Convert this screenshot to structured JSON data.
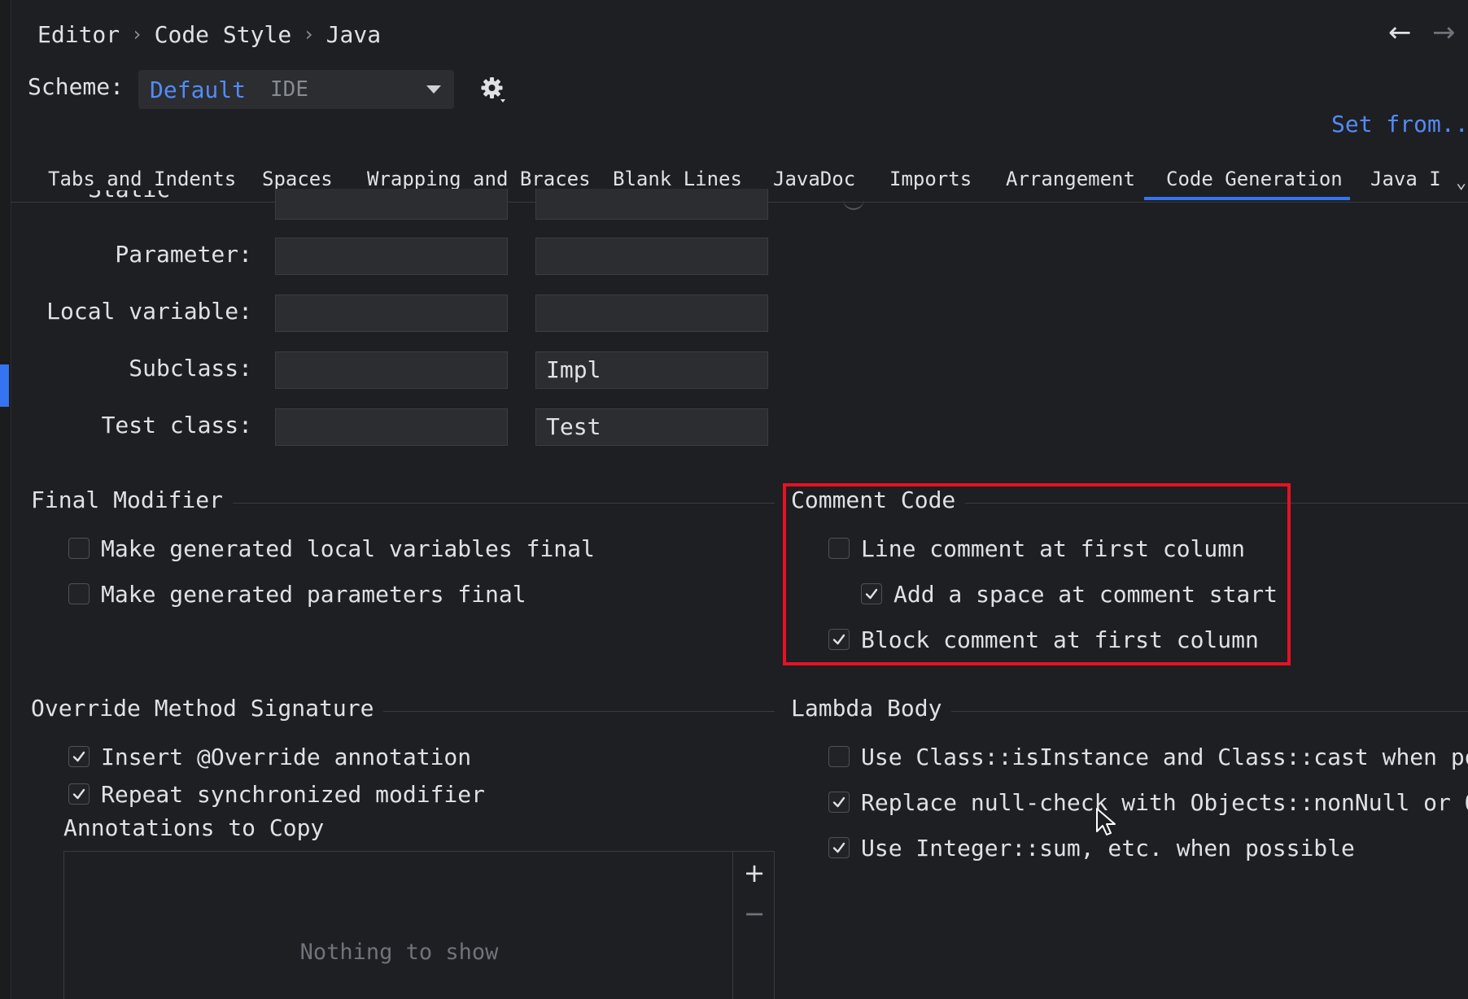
{
  "breadcrumb": [
    "Editor",
    "Code Style",
    "Java"
  ],
  "breadcrumb_separator": "›",
  "nav": {
    "back": "←",
    "forward": "→"
  },
  "scheme": {
    "label": "Scheme:",
    "name": "Default",
    "type": "IDE",
    "set_from": "Set from..."
  },
  "tabs": [
    {
      "label": "Tabs and Indents",
      "active": false
    },
    {
      "label": "Spaces",
      "active": false
    },
    {
      "label": "Wrapping and Braces",
      "active": false
    },
    {
      "label": "Blank Lines",
      "active": false
    },
    {
      "label": "JavaDoc",
      "active": false
    },
    {
      "label": "Imports",
      "active": false
    },
    {
      "label": "Arrangement",
      "active": false
    },
    {
      "label": "Code Generation",
      "active": true
    },
    {
      "label": "Java I",
      "active": false
    }
  ],
  "naming": {
    "cut_off_label": "Static field:",
    "rows": [
      {
        "label": "Parameter:",
        "prefix": "",
        "suffix": ""
      },
      {
        "label": "Local variable:",
        "prefix": "",
        "suffix": ""
      },
      {
        "label": "Subclass:",
        "prefix": "",
        "suffix": "Impl"
      },
      {
        "label": "Test class:",
        "prefix": "",
        "suffix": "Test"
      }
    ]
  },
  "final_modifier": {
    "title": "Final Modifier",
    "options": [
      {
        "label": "Make generated local variables final",
        "checked": false
      },
      {
        "label": "Make generated parameters final",
        "checked": false
      }
    ]
  },
  "comment_code": {
    "title": "Comment Code",
    "options": [
      {
        "label": "Line comment at first column",
        "checked": false
      },
      {
        "label": "Add a space at comment start",
        "checked": true
      },
      {
        "label": "Block comment at first column",
        "checked": true
      }
    ]
  },
  "override_method": {
    "title": "Override Method Signature",
    "options": [
      {
        "label": "Insert @Override annotation",
        "checked": true
      },
      {
        "label": "Repeat synchronized modifier",
        "checked": true
      }
    ],
    "annotations_label": "Annotations to Copy",
    "empty_text": "Nothing to show"
  },
  "lambda_body": {
    "title": "Lambda Body",
    "options": [
      {
        "label": "Use Class::isInstance and Class::cast when possi",
        "checked": false
      },
      {
        "label": "Replace null-check with Objects::nonNull or Obje",
        "checked": true
      },
      {
        "label": "Use Integer::sum, etc. when possible",
        "checked": true
      }
    ]
  },
  "colors": {
    "accent": "#3574f0",
    "link": "#548af7",
    "background": "#1e1f22",
    "highlight": "#e81123"
  }
}
